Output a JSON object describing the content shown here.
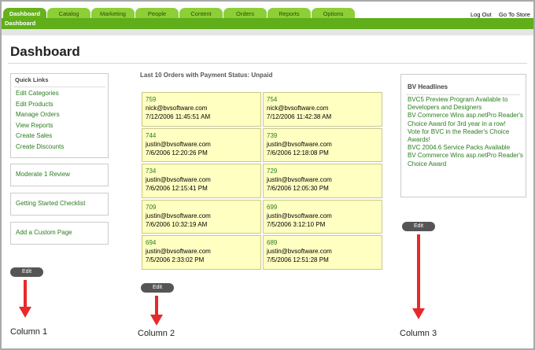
{
  "tabs": [
    "Dashboard",
    "Catalog",
    "Marketing",
    "People",
    "Content",
    "Orders",
    "Reports",
    "Options"
  ],
  "top_links": {
    "logout": "Log Out",
    "goto_store": "Go To Store"
  },
  "breadcrumb": "Dashboard",
  "page_title": "Dashboard",
  "quick_links": {
    "title": "Quick Links",
    "items": [
      "Edit Categories",
      "Edit Products",
      "Manage Orders",
      "View Reports",
      "Create Sales",
      "Create Discounts"
    ]
  },
  "sidebar_boxes": {
    "moderate": "Moderate 1 Review",
    "checklist": "Getting Started Checklist",
    "custom_page": "Add a Custom Page"
  },
  "orders": {
    "title": "Last 10 Orders with Payment Status: Unpaid",
    "items": [
      {
        "id": "759",
        "email": "nick@bvsoftware.com",
        "date": "7/12/2006 11:45:51 AM"
      },
      {
        "id": "754",
        "email": "nick@bvsoftware.com",
        "date": "7/12/2006 11:42:38 AM"
      },
      {
        "id": "744",
        "email": "justin@bvsoftware.com",
        "date": "7/6/2006 12:20:26 PM"
      },
      {
        "id": "739",
        "email": "justin@bvsoftware.com",
        "date": "7/6/2006 12:18:08 PM"
      },
      {
        "id": "734",
        "email": "justin@bvsoftware.com",
        "date": "7/6/2006 12:15:41 PM"
      },
      {
        "id": "729",
        "email": "justin@bvsoftware.com",
        "date": "7/6/2006 12:05:30 PM"
      },
      {
        "id": "709",
        "email": "justin@bvsoftware.com",
        "date": "7/6/2006 10:32:19 AM"
      },
      {
        "id": "699",
        "email": "justin@bvsoftware.com",
        "date": "7/5/2006 3:12:10 PM"
      },
      {
        "id": "694",
        "email": "justin@bvsoftware.com",
        "date": "7/5/2006 2:33:02 PM"
      },
      {
        "id": "689",
        "email": "justin@bvsoftware.com",
        "date": "7/5/2006 12:51:28 PM"
      }
    ]
  },
  "headlines": {
    "title": "BV Headlines",
    "items": [
      "BVC5 Preview Program Available to Developers and Designers",
      "BV Commerce Wins asp.netPro Reader's Choice Award for 3rd year in a row!",
      "Vote for BVC in the Reader's Choice Awards!",
      "BVC 2004.6 Service Packs Available",
      "BV Commerce Wins asp.netPro Reader's Choice Award"
    ]
  },
  "edit_label": "Edit",
  "column_labels": [
    "Column 1",
    "Column 2",
    "Column 3"
  ],
  "colors": {
    "nav_green": "#5fae1a",
    "tab_green": "#8ccf36",
    "link_green": "#2a7d1e",
    "order_bg": "#ffffc2",
    "arrow_red": "#e8282b"
  }
}
